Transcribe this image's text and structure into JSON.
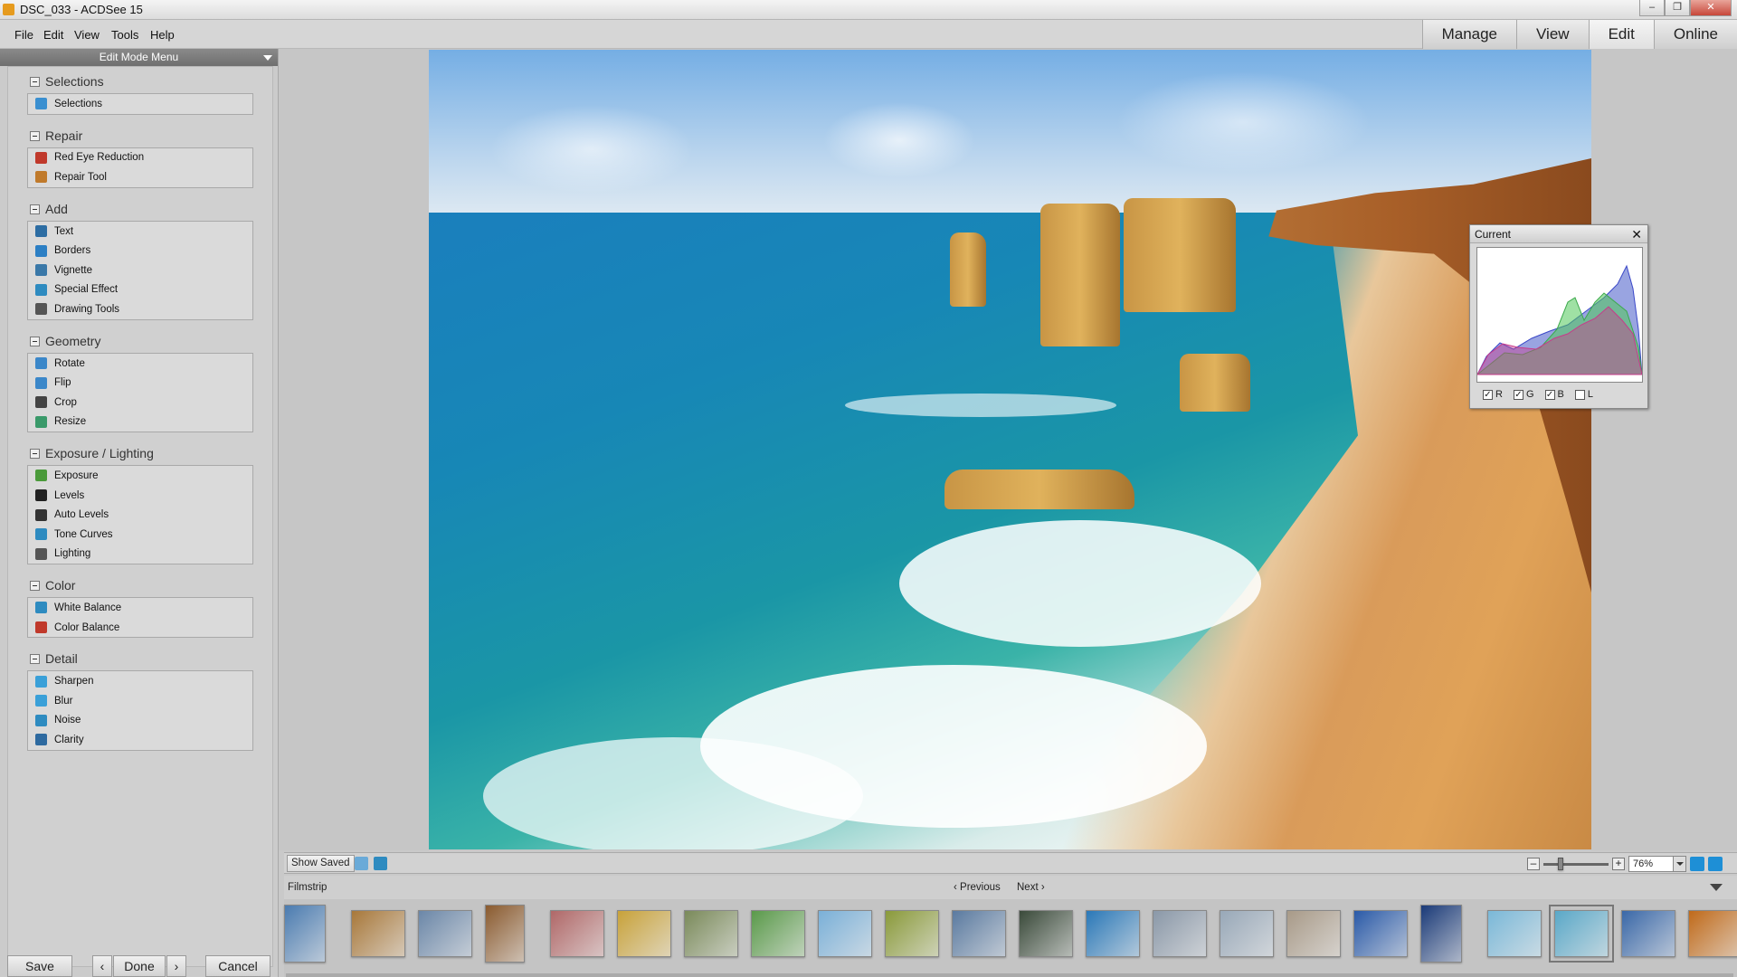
{
  "window": {
    "title": "DSC_033 - ACDSee 15",
    "buttons": [
      "–",
      "❐",
      "✕"
    ]
  },
  "menu": [
    "File",
    "Edit",
    "View",
    "Tools",
    "Help"
  ],
  "mode_tabs": [
    "Manage",
    "View",
    "Edit",
    "Online"
  ],
  "active_mode": "Edit",
  "panel_title": "Edit Mode Menu",
  "groups": [
    {
      "title": "Selections",
      "items": [
        {
          "label": "Selections",
          "icon": "selection-icon",
          "color": "#3a8fd0"
        }
      ]
    },
    {
      "title": "Repair",
      "items": [
        {
          "label": "Red Eye Reduction",
          "icon": "eye-icon",
          "color": "#c0392b"
        },
        {
          "label": "Repair Tool",
          "icon": "bandaid-icon",
          "color": "#c07a2b"
        }
      ]
    },
    {
      "title": "Add",
      "items": [
        {
          "label": "Text",
          "icon": "text-icon",
          "color": "#2d6da3"
        },
        {
          "label": "Borders",
          "icon": "borders-icon",
          "color": "#2c7fc4"
        },
        {
          "label": "Vignette",
          "icon": "vignette-icon",
          "color": "#3a78a8"
        },
        {
          "label": "Special Effect",
          "icon": "special-effect-icon",
          "color": "#2e8bc0"
        },
        {
          "label": "Drawing Tools",
          "icon": "drawing-tools-icon",
          "color": "#555555"
        }
      ]
    },
    {
      "title": "Geometry",
      "items": [
        {
          "label": "Rotate",
          "icon": "rotate-icon",
          "color": "#3b87c9"
        },
        {
          "label": "Flip",
          "icon": "flip-icon",
          "color": "#3b87c9"
        },
        {
          "label": "Crop",
          "icon": "crop-icon",
          "color": "#444444"
        },
        {
          "label": "Resize",
          "icon": "resize-icon",
          "color": "#3a9a6a"
        }
      ]
    },
    {
      "title": "Exposure / Lighting",
      "items": [
        {
          "label": "Exposure",
          "icon": "exposure-icon",
          "color": "#4a9a3a"
        },
        {
          "label": "Levels",
          "icon": "levels-icon",
          "color": "#222222"
        },
        {
          "label": "Auto Levels",
          "icon": "auto-levels-icon",
          "color": "#333333"
        },
        {
          "label": "Tone Curves",
          "icon": "tone-curves-icon",
          "color": "#2e8bc0"
        },
        {
          "label": "Lighting",
          "icon": "lighting-icon",
          "color": "#555555"
        }
      ]
    },
    {
      "title": "Color",
      "items": [
        {
          "label": "White Balance",
          "icon": "white-balance-icon",
          "color": "#2e8bc0"
        },
        {
          "label": "Color Balance",
          "icon": "color-balance-icon",
          "color": "#c0392b"
        }
      ]
    },
    {
      "title": "Detail",
      "items": [
        {
          "label": "Sharpen",
          "icon": "sharpen-icon",
          "color": "#3aa0d8"
        },
        {
          "label": "Blur",
          "icon": "blur-icon",
          "color": "#3aa0d8"
        },
        {
          "label": "Noise",
          "icon": "noise-icon",
          "color": "#2e8bc0"
        },
        {
          "label": "Clarity",
          "icon": "clarity-icon",
          "color": "#2e6aa0"
        }
      ]
    }
  ],
  "bottom_buttons": {
    "save": "Save",
    "prev": "‹",
    "done": "Done",
    "next": "›",
    "cancel": "Cancel"
  },
  "histogram": {
    "title": "Current",
    "close": "✕",
    "channels": [
      {
        "label": "R",
        "checked": true,
        "mark": "✓"
      },
      {
        "label": "G",
        "checked": true,
        "mark": "✓"
      },
      {
        "label": "B",
        "checked": true,
        "mark": "✓"
      },
      {
        "label": "L",
        "checked": false,
        "mark": ""
      }
    ]
  },
  "statusbar": {
    "show_saved": "Show Saved",
    "zoom": "76%",
    "zoom_minus": "–",
    "zoom_plus": "+"
  },
  "filmstrip": {
    "label": "Filmstrip",
    "previous": "‹ Previous",
    "next": "Next ›",
    "selected_index": 19,
    "thumbnails": [
      {
        "color": "#4a7bb0",
        "w": 46
      },
      {
        "color": "#a8783a",
        "w": 60
      },
      {
        "color": "#6b87a8",
        "w": 60
      },
      {
        "color": "#8a5a2e",
        "w": 44
      },
      {
        "color": "#b06868",
        "w": 60
      },
      {
        "color": "#c8a23a",
        "w": 60
      },
      {
        "color": "#7a8a5a",
        "w": 60
      },
      {
        "color": "#5a9a4a",
        "w": 60
      },
      {
        "color": "#7ab0d8",
        "w": 60
      },
      {
        "color": "#8a9a3a",
        "w": 60
      },
      {
        "color": "#5a7aa0",
        "w": 60
      },
      {
        "color": "#3a4a3a",
        "w": 60
      },
      {
        "color": "#2a78b8",
        "w": 60
      },
      {
        "color": "#8a98a8",
        "w": 60
      },
      {
        "color": "#98a8b8",
        "w": 60
      },
      {
        "color": "#a89a88",
        "w": 60
      },
      {
        "color": "#2a5aa8",
        "w": 60
      },
      {
        "color": "#1a3a78",
        "w": 46
      },
      {
        "color": "#7ab8d8",
        "w": 60
      },
      {
        "color": "#5aa8c8",
        "w": 60
      },
      {
        "color": "#3a68a8",
        "w": 60
      },
      {
        "color": "#c06a1a",
        "w": 60
      }
    ]
  }
}
